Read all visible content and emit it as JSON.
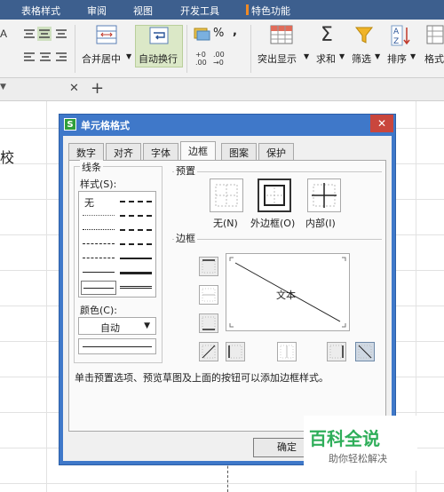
{
  "menubar": {
    "items": [
      "表格样式",
      "审阅",
      "视图",
      "开发工具",
      "特色功能"
    ],
    "bg": "#3d5f8e"
  },
  "ribbon": {
    "merge_center": "合并居中",
    "wrap_text": "自动换行",
    "highlight": "突出显示",
    "sum": "求和",
    "filter": "筛选",
    "sort": "排序",
    "format": "格式"
  },
  "sheet": {
    "cell_text": "校"
  },
  "dialog": {
    "title": "单元格格式",
    "logo": "S",
    "close": "✕",
    "tabs": [
      "数字",
      "对齐",
      "字体",
      "边框",
      "图案",
      "保护"
    ],
    "active_tab": "边框",
    "line_group": "线条",
    "style_label": "样式(S):",
    "style_none": "无",
    "color_label": "颜色(C):",
    "color_value": "自动",
    "preset_group": "预置",
    "presets": [
      "无(N)",
      "外边框(O)",
      "内部(I)"
    ],
    "border_group": "边框",
    "preview_text": "文本",
    "hint": "单击预置选项、预览草图及上面的按钮可以添加边框样式。",
    "ok": "确定"
  },
  "watermark": {
    "big": "百科全说",
    "small": "助你轻松解决"
  },
  "colors": {
    "title_bar": "#3f78c9",
    "highlight": "#dbe8c7",
    "watermark": "#2fae5a"
  }
}
